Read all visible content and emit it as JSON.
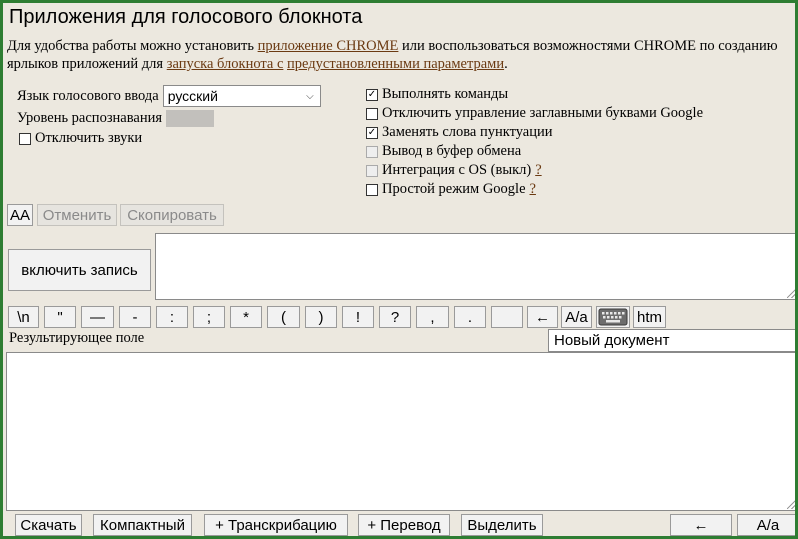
{
  "title": "Приложения для голосового блокнота",
  "intro": {
    "t1": "Для удобства работы можно установить ",
    "link1": "приложение CHROME",
    "t2": " или воспользоваться возможностями CHROME по созданию ярлыков приложений для ",
    "link2": "запуска блокнота с",
    "t3": " ",
    "link3": "предустановленными параметрами",
    "t4": "."
  },
  "voice": {
    "lang_label": "Язык голосового ввода",
    "lang_value": "русский",
    "level_label": "Уровень распознавания",
    "mute_label": "Отключить звуки",
    "mute_checked": false
  },
  "options": [
    {
      "label": "Выполнять команды",
      "checked": true,
      "disabled": false,
      "help": ""
    },
    {
      "label": "Отключить управление заглавными буквами Google",
      "checked": false,
      "disabled": false,
      "help": ""
    },
    {
      "label": "Заменять слова пунктуации",
      "checked": true,
      "disabled": false,
      "help": ""
    },
    {
      "label": "Вывод в буфер обмена",
      "checked": false,
      "disabled": true,
      "help": ""
    },
    {
      "label": "Интеграция с OS (выкл)",
      "checked": false,
      "disabled": true,
      "help": "?"
    },
    {
      "label": "Простой режим Google",
      "checked": false,
      "disabled": false,
      "help": "?"
    }
  ],
  "toolbar": {
    "aa": "AA",
    "cancel": "Отменить",
    "copy": "Скопировать"
  },
  "record_button": "включить запись",
  "symbols": [
    "\\n",
    "\"",
    "—",
    "-",
    ":",
    ";",
    "*",
    "(",
    ")",
    "!",
    "?",
    ",",
    ".",
    " ",
    "←",
    "A/a"
  ],
  "htm_button": "htm",
  "result_label": "Результирующее поле",
  "doc_name": "Новый документ",
  "bottom": {
    "download": "Скачать",
    "compact": "Компактный",
    "transcribe": "+ Транскрибацию",
    "translate": "+ Перевод",
    "select": "Выделить",
    "back": "←",
    "case": "A/a"
  }
}
